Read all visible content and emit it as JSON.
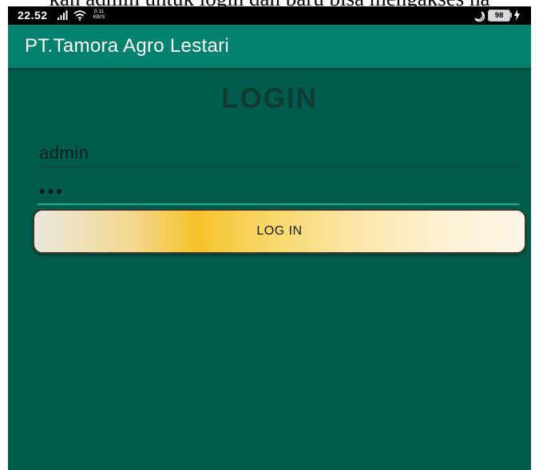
{
  "caption": "kan admin untuk login dan baru bisa mengakses ha",
  "status_bar": {
    "time": "22.52",
    "net_speed_value": "0.11",
    "net_speed_unit": "KB/S",
    "battery_level": "98",
    "icons": [
      "signal-icon",
      "wifi-icon",
      "moon-icon",
      "battery-icon",
      "charging-bolt-icon"
    ]
  },
  "app_bar": {
    "title": "PT.Tamora Agro Lestari",
    "color": "#04826d"
  },
  "login_form": {
    "heading": "LOGIN",
    "username_value": "admin",
    "password_value": "•••",
    "submit_label": "LOG IN"
  },
  "colors": {
    "background": "#025c4d",
    "accent": "#0fb39a",
    "button_highlight": "#f6c22a"
  }
}
